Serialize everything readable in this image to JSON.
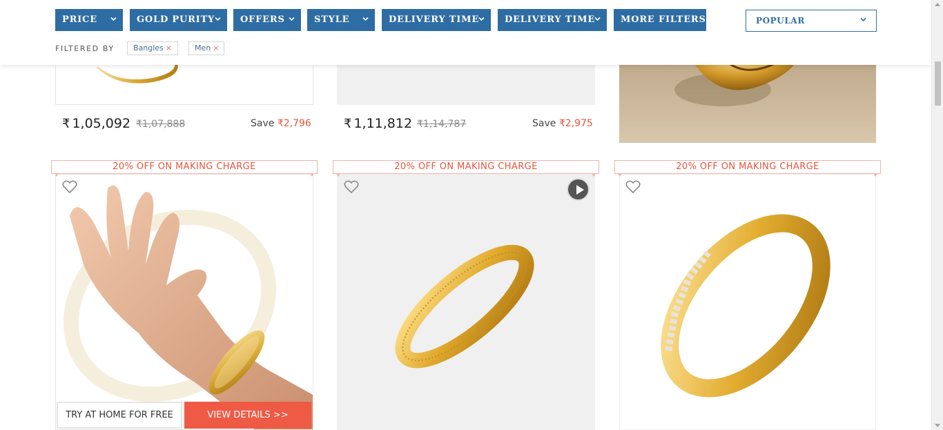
{
  "filters": {
    "buttons": [
      {
        "label": "PRICE"
      },
      {
        "label": "GOLD PURITY"
      },
      {
        "label": "OFFERS"
      },
      {
        "label": "STYLE"
      },
      {
        "label": "DELIVERY TIME"
      },
      {
        "label": "DELIVERY TIME"
      },
      {
        "label": "MORE FILTERS"
      }
    ],
    "sort_label": "POPULAR",
    "filtered_by_label": "FILTERED BY",
    "chips": [
      {
        "label": "Bangles",
        "remove": "×"
      },
      {
        "label": "Men",
        "remove": "×"
      }
    ],
    "accent_color": "#2e6da4"
  },
  "products_row1": [
    {
      "currency": "₹",
      "price": "1,05,092",
      "mrp": "₹1,07,888",
      "save_label": "Save",
      "save_amount": "₹2,796"
    },
    {
      "currency": "₹",
      "price": "1,11,812",
      "mrp": "₹1,14,787",
      "save_label": "Save",
      "save_amount": "₹2,975"
    }
  ],
  "products_row2": [
    {
      "offer": "20% OFF ON MAKING CHARGE"
    },
    {
      "offer": "20% OFF ON MAKING CHARGE"
    },
    {
      "offer": "20% OFF ON MAKING CHARGE"
    }
  ],
  "actions": {
    "try_at_home": "TRY AT HOME FOR FREE",
    "view_details": "VIEW DETAILS >>"
  },
  "colors": {
    "offer_red": "#e8553f",
    "button_red": "#ef5a45"
  },
  "icons": [
    "heart-icon",
    "play-icon",
    "chevron-down-icon",
    "close-icon"
  ]
}
